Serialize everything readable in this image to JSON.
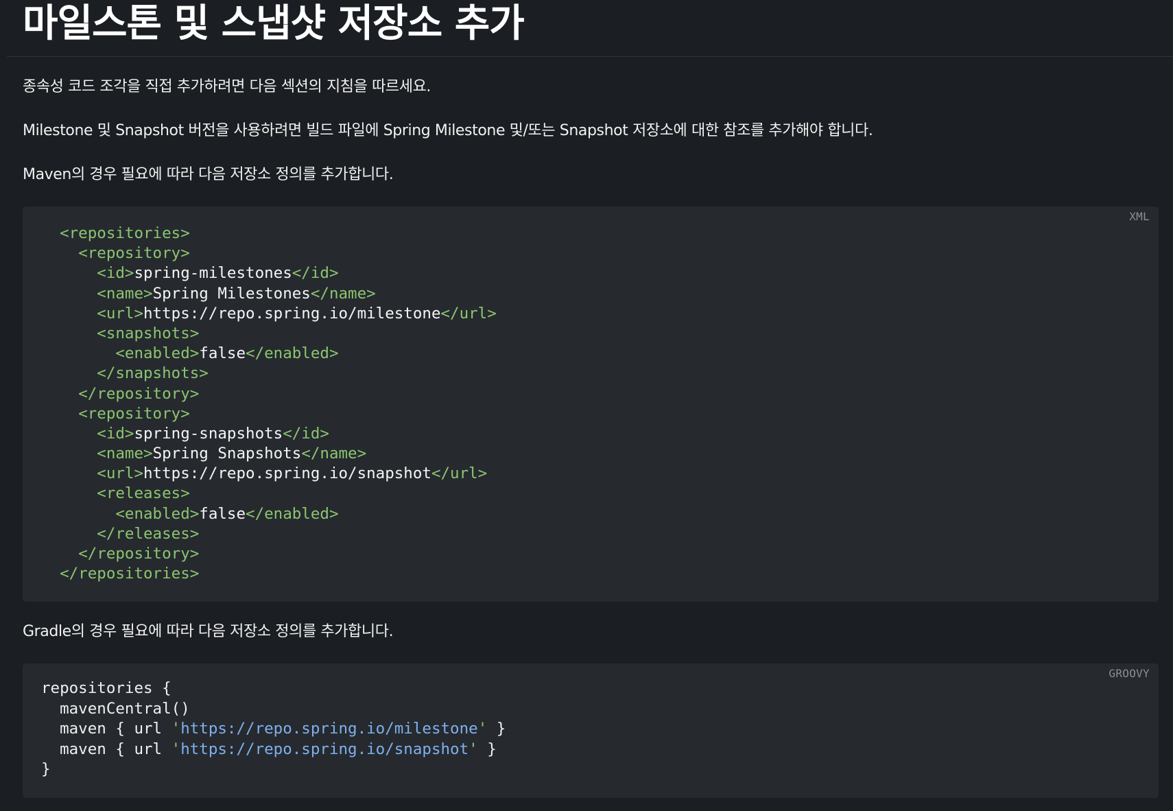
{
  "page": {
    "title": "마일스톤 및 스냅샷 저장소 추가",
    "paragraphs": [
      "종속성 코드 조각을 직접 추가하려면 다음 섹션의 지침을 따르세요.",
      "Milestone 및 Snapshot 버전을 사용하려면 빌드 파일에 Spring Milestone 및/또는 Snapshot 저장소에 대한 참조를 추가해야 합니다.",
      "Maven의 경우 필요에 따라 다음 저장소 정의를 추가합니다.",
      "Gradle의 경우 필요에 따라 다음 저장소 정의를 추가합니다."
    ]
  },
  "maven_block": {
    "language": "XML",
    "lines": [
      [
        {
          "t": "  "
        },
        {
          "tag": "<repositories>"
        }
      ],
      [
        {
          "t": "    "
        },
        {
          "tag": "<repository>"
        }
      ],
      [
        {
          "t": "      "
        },
        {
          "tag": "<id>"
        },
        {
          "text": "spring-milestones"
        },
        {
          "tag": "</id>"
        }
      ],
      [
        {
          "t": "      "
        },
        {
          "tag": "<name>"
        },
        {
          "text": "Spring Milestones"
        },
        {
          "tag": "</name>"
        }
      ],
      [
        {
          "t": "      "
        },
        {
          "tag": "<url>"
        },
        {
          "text": "https://repo.spring.io/milestone"
        },
        {
          "tag": "</url>"
        }
      ],
      [
        {
          "t": "      "
        },
        {
          "tag": "<snapshots>"
        }
      ],
      [
        {
          "t": "        "
        },
        {
          "tag": "<enabled>"
        },
        {
          "text": "false"
        },
        {
          "tag": "</enabled>"
        }
      ],
      [
        {
          "t": "      "
        },
        {
          "tag": "</snapshots>"
        }
      ],
      [
        {
          "t": "    "
        },
        {
          "tag": "</repository>"
        }
      ],
      [
        {
          "t": "    "
        },
        {
          "tag": "<repository>"
        }
      ],
      [
        {
          "t": "      "
        },
        {
          "tag": "<id>"
        },
        {
          "text": "spring-snapshots"
        },
        {
          "tag": "</id>"
        }
      ],
      [
        {
          "t": "      "
        },
        {
          "tag": "<name>"
        },
        {
          "text": "Spring Snapshots"
        },
        {
          "tag": "</name>"
        }
      ],
      [
        {
          "t": "      "
        },
        {
          "tag": "<url>"
        },
        {
          "text": "https://repo.spring.io/snapshot"
        },
        {
          "tag": "</url>"
        }
      ],
      [
        {
          "t": "      "
        },
        {
          "tag": "<releases>"
        }
      ],
      [
        {
          "t": "        "
        },
        {
          "tag": "<enabled>"
        },
        {
          "text": "false"
        },
        {
          "tag": "</enabled>"
        }
      ],
      [
        {
          "t": "      "
        },
        {
          "tag": "</releases>"
        }
      ],
      [
        {
          "t": "    "
        },
        {
          "tag": "</repository>"
        }
      ],
      [
        {
          "t": "  "
        },
        {
          "tag": "</repositories>"
        }
      ]
    ]
  },
  "gradle_block": {
    "language": "GROOVY",
    "lines": [
      [
        {
          "plain": "repositories {"
        }
      ],
      [
        {
          "plain": "  mavenCentral()"
        }
      ],
      [
        {
          "plain": "  maven { url "
        },
        {
          "quote": "'"
        },
        {
          "str": "https://repo.spring.io/milestone"
        },
        {
          "quote": "'"
        },
        {
          "plain": " }"
        }
      ],
      [
        {
          "plain": "  maven { url "
        },
        {
          "quote": "'"
        },
        {
          "str": "https://repo.spring.io/snapshot"
        },
        {
          "quote": "'"
        },
        {
          "plain": " }"
        }
      ],
      [
        {
          "plain": "}"
        }
      ]
    ]
  },
  "colors": {
    "background": "#1b1e22",
    "code_background": "#262a2f",
    "xml_tag": "#8cc570",
    "string": "#7fb0ec",
    "label": "#8b8f94"
  }
}
